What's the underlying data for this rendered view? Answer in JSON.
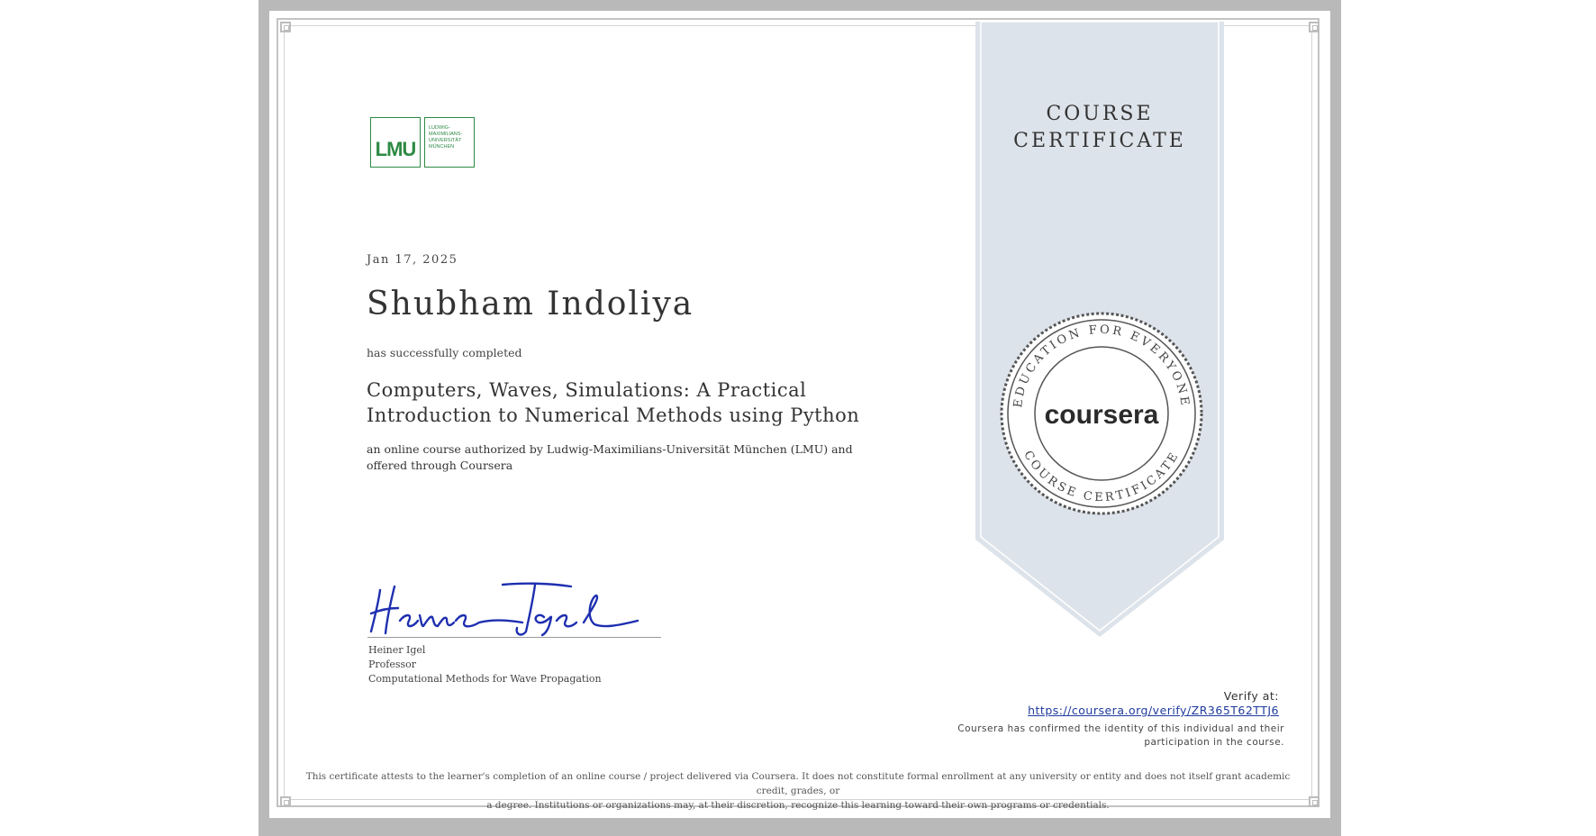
{
  "logo": {
    "mark": "LMU",
    "subtext": "LUDWIG-MAXIMILIANS-UNIVERSITÄT MÜNCHEN",
    "color": "#2e8a44"
  },
  "certificate": {
    "date": "Jan 17, 2025",
    "recipient": "Shubham Indoliya",
    "completed_text": "has successfully completed",
    "course_title": "Computers, Waves, Simulations: A Practical Introduction to Numerical Methods using Python",
    "description": "an online course authorized by Ludwig-Maximilians-Universität München (LMU) and offered through Coursera"
  },
  "signatory": {
    "name": "Heiner Igel",
    "role": "Professor",
    "department": "Computational Methods for Wave Propagation"
  },
  "ribbon": {
    "line1": "COURSE",
    "line2": "CERTIFICATE",
    "color": "#dde3ea"
  },
  "seal": {
    "brand": "coursera",
    "top_text": "EDUCATION FOR EVERYONE",
    "bottom_text": "COURSE CERTIFICATE"
  },
  "verify": {
    "label": "Verify at:",
    "url": "https://coursera.org/verify/ZR365T62TTJ6",
    "confirm": "Coursera has confirmed the identity of this individual and their participation in the course."
  },
  "footer": {
    "line1": "This certificate attests to the learner's completion of an online course / project delivered via Coursera. It does not constitute formal enrollment at any university or entity and does not itself grant academic credit, grades, or",
    "line2": "a degree. Institutions or organizations may, at their discretion, recognize this learning toward their own programs or credentials."
  }
}
